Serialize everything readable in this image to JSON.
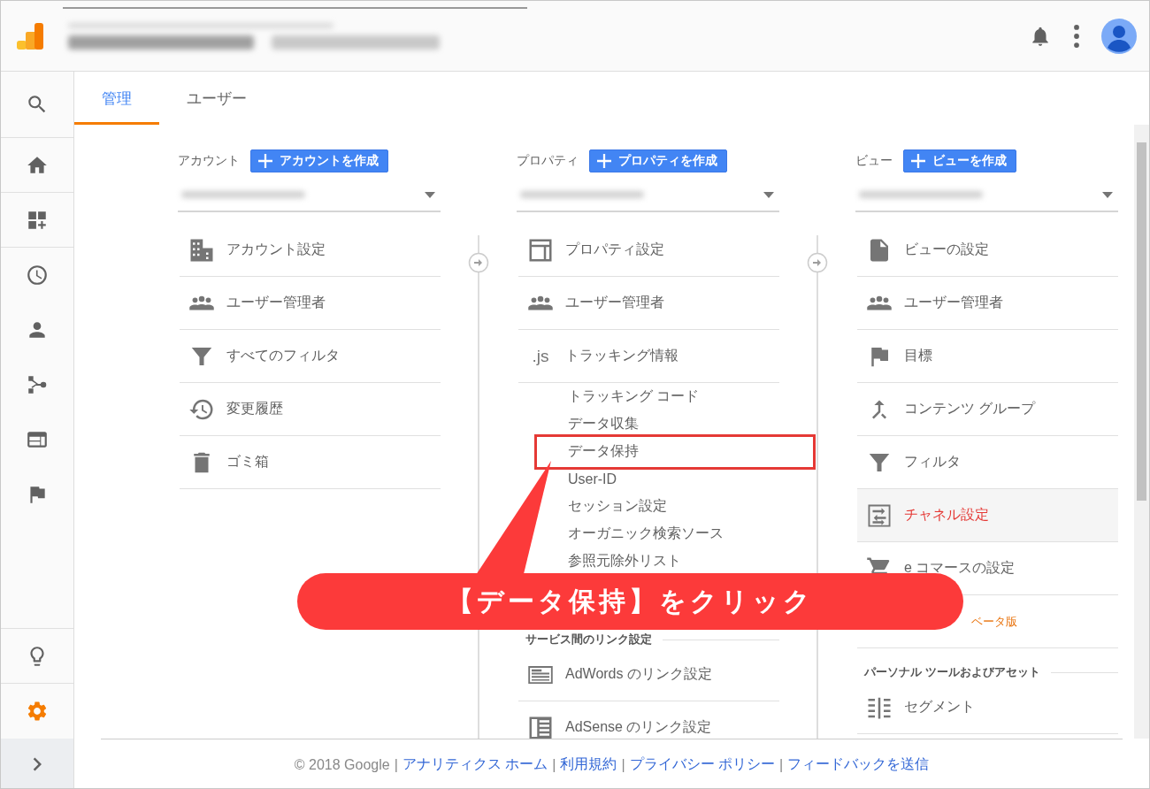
{
  "sidebar": {
    "items": [
      {
        "selected": false
      },
      {
        "selected": false
      },
      {
        "selected": false
      },
      {
        "selected": false
      },
      {
        "selected": false
      },
      {
        "selected": false
      },
      {
        "selected": false
      },
      {
        "selected": false
      },
      {
        "selected": false
      },
      {
        "selected": true
      }
    ]
  },
  "tabs": [
    {
      "label": "管理",
      "selected": true
    },
    {
      "label": "ユーザー",
      "selected": false
    }
  ],
  "columns": [
    {
      "label": "アカウント",
      "create_button": "アカウントを作成",
      "items": [
        {
          "kind": "row",
          "label": "アカウント設定",
          "selected": false
        },
        {
          "kind": "row",
          "label": "ユーザー管理者",
          "selected": false
        },
        {
          "kind": "row",
          "label": "すべてのフィルタ",
          "selected": false
        },
        {
          "kind": "row",
          "label": "変更履歴",
          "selected": false
        },
        {
          "kind": "row",
          "label": "ゴミ箱",
          "selected": false
        }
      ]
    },
    {
      "label": "プロパティ",
      "create_button": "プロパティを作成",
      "items": [
        {
          "kind": "row",
          "label": "プロパティ設定",
          "selected": false
        },
        {
          "kind": "row",
          "label": "ユーザー管理者",
          "selected": false
        },
        {
          "kind": "row",
          "label": "トラッキング情報",
          "icon_text": ".js",
          "selected": false
        },
        {
          "kind": "sub",
          "label": "トラッキング コード"
        },
        {
          "kind": "sub",
          "label": "データ収集"
        },
        {
          "kind": "sub",
          "label": "データ保持"
        },
        {
          "kind": "sub",
          "label": "User-ID"
        },
        {
          "kind": "sub",
          "label": "セッション設定"
        },
        {
          "kind": "sub",
          "label": "オーガニック検索ソース"
        },
        {
          "kind": "sub",
          "label": "参照元除外リスト"
        },
        {
          "kind": "section",
          "label": "サービス間のリンク設定"
        },
        {
          "kind": "row",
          "label": "AdWords のリンク設定",
          "selected": false
        },
        {
          "kind": "row",
          "label": "AdSense のリンク設定",
          "selected": false
        }
      ]
    },
    {
      "label": "ビュー",
      "create_button": "ビューを作成",
      "items": [
        {
          "kind": "row",
          "label": "ビューの設定",
          "selected": false
        },
        {
          "kind": "row",
          "label": "ユーザー管理者",
          "selected": false
        },
        {
          "kind": "row",
          "label": "目標",
          "selected": false
        },
        {
          "kind": "row",
          "label": "コンテンツ グループ",
          "selected": false
        },
        {
          "kind": "row",
          "label": "フィルタ",
          "selected": false
        },
        {
          "kind": "row",
          "label": "チャネル設定",
          "selected": true
        },
        {
          "kind": "row",
          "label": "e コマースの設定",
          "selected": false
        },
        {
          "kind": "row",
          "badge": "ベータ版"
        },
        {
          "kind": "section",
          "label": "パーソナル ツールおよびアセット"
        },
        {
          "kind": "row",
          "label": "セグメント",
          "selected": false
        }
      ]
    }
  ],
  "footer": {
    "copyright": "© 2018 Google",
    "separator": "|",
    "links": [
      "アナリティクス ホーム",
      "利用規約",
      "プライバシー ポリシー",
      "フィードバックを送信"
    ]
  },
  "callout": {
    "text": "【データ保持】をクリック"
  }
}
